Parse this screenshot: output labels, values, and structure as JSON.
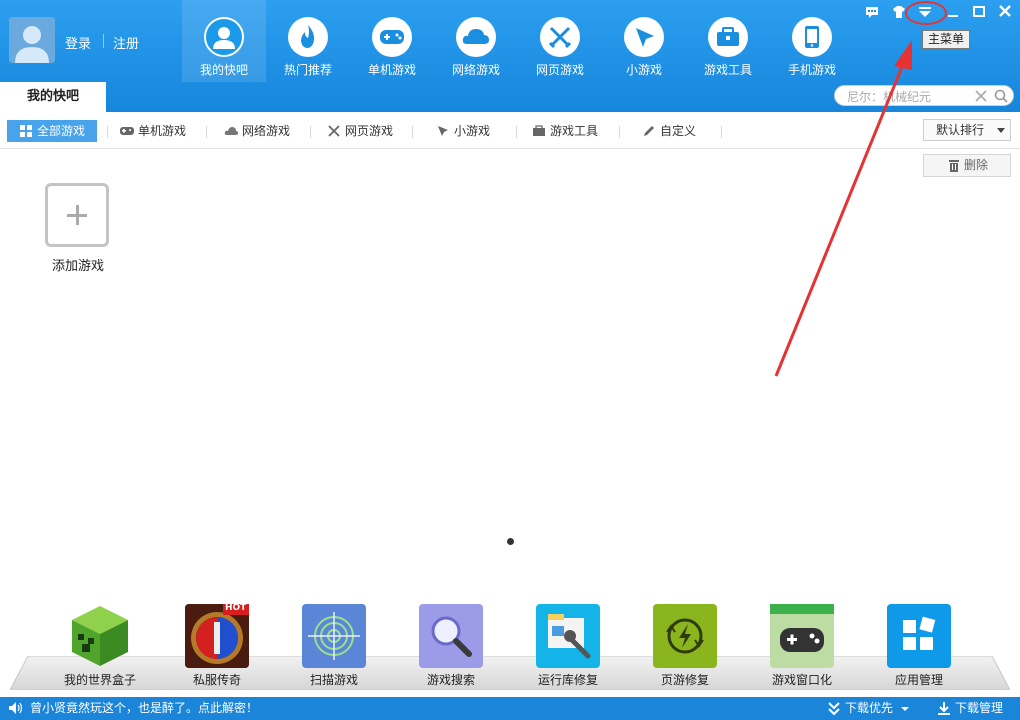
{
  "header": {
    "login": "登录",
    "register": "注册",
    "nav": [
      {
        "label": "我的快吧",
        "icon": "user-icon",
        "active": true
      },
      {
        "label": "热门推荐",
        "icon": "fire-icon"
      },
      {
        "label": "单机游戏",
        "icon": "gamepad-icon"
      },
      {
        "label": "网络游戏",
        "icon": "cloud-icon"
      },
      {
        "label": "网页游戏",
        "icon": "crossed-swords-icon"
      },
      {
        "label": "小游戏",
        "icon": "cursor-icon"
      },
      {
        "label": "游戏工具",
        "icon": "toolbox-icon"
      },
      {
        "label": "手机游戏",
        "icon": "phone-icon"
      }
    ],
    "tooltip": "主菜单",
    "window_buttons": [
      "message-icon",
      "skin-icon",
      "main-menu-icon",
      "minimize-icon",
      "maximize-icon",
      "close-icon"
    ]
  },
  "tab": {
    "label": "我的快吧"
  },
  "search": {
    "placeholder": "尼尔：机械纪元"
  },
  "categories": [
    {
      "label": "全部游戏",
      "icon": "grid-icon",
      "active": true
    },
    {
      "label": "单机游戏",
      "icon": "gamepad-icon"
    },
    {
      "label": "网络游戏",
      "icon": "cloud-icon"
    },
    {
      "label": "网页游戏",
      "icon": "crossed-swords-icon"
    },
    {
      "label": "小游戏",
      "icon": "cursor-icon"
    },
    {
      "label": "游戏工具",
      "icon": "toolbox-icon"
    },
    {
      "label": "自定义",
      "icon": "pen-icon"
    }
  ],
  "sort": {
    "label": "默认排行"
  },
  "delete": {
    "label": "删除"
  },
  "add_game": {
    "label": "添加游戏"
  },
  "tools": [
    {
      "label": "我的世界盒子"
    },
    {
      "label": "私服传奇",
      "badge": "HOT"
    },
    {
      "label": "扫描游戏"
    },
    {
      "label": "游戏搜索"
    },
    {
      "label": "运行库修复"
    },
    {
      "label": "页游修复"
    },
    {
      "label": "游戏窗口化"
    },
    {
      "label": "应用管理"
    }
  ],
  "status": {
    "message": "曾小贤竟然玩这个，也是醉了。点此解密！",
    "download_priority": "下载优先",
    "download_manager": "下载管理"
  },
  "colors": {
    "header_blue": "#1a8fe0",
    "active_tab": "#48a3ea",
    "annotation_red": "#e53333"
  }
}
